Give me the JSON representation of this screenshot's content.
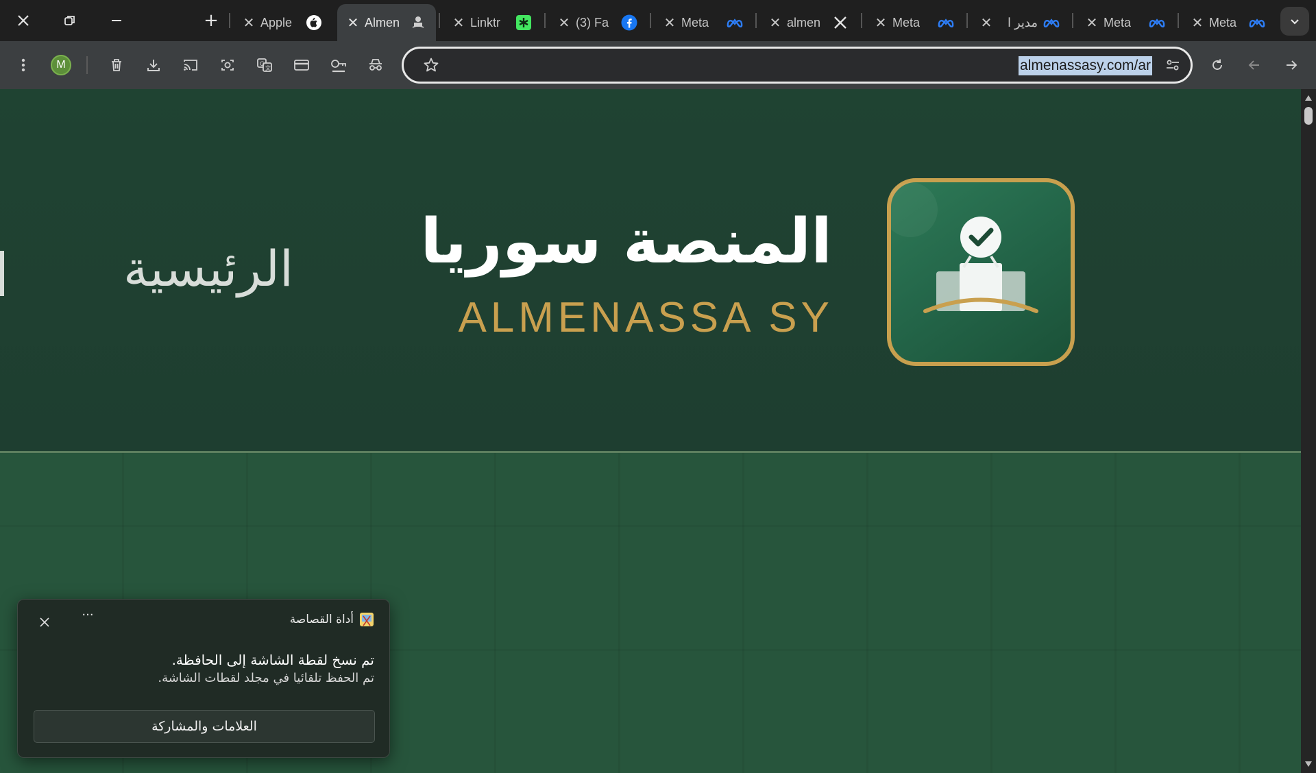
{
  "tabs": [
    {
      "title": "Apple",
      "favicon": "apple-icon"
    },
    {
      "title": "Almen",
      "favicon": "almenassa-icon",
      "active": true
    },
    {
      "title": "Linktr",
      "favicon": "linktree-icon"
    },
    {
      "title": "(3) Fa",
      "favicon": "facebook-icon"
    },
    {
      "title": "Meta",
      "favicon": "meta-icon"
    },
    {
      "title": "almen",
      "favicon": "x-icon"
    },
    {
      "title": "Meta",
      "favicon": "meta-icon"
    },
    {
      "title": "مدير ا",
      "favicon": "meta-icon"
    },
    {
      "title": "Meta",
      "favicon": "meta-icon"
    },
    {
      "title": "Meta",
      "favicon": "meta-icon"
    }
  ],
  "toolbar": {
    "avatar_initial": "M",
    "url": "almenassasy.com/ar"
  },
  "page": {
    "nav_home": "الرئيسية",
    "logo_ar": "المنصة سوريا",
    "logo_en": "ALMENASSA SY"
  },
  "toast": {
    "app_name": "أداة القصاصة",
    "line1": "تم نسخ لقطة الشاشة إلى الحافظة.",
    "line2": "تم الحفظ تلقائيا في مجلد لقطات الشاشة.",
    "button": "العلامات والمشاركة",
    "more": "···"
  },
  "colors": {
    "hero_bg": "#1f4332",
    "content_bg": "#27553c",
    "gold": "#c9a04f",
    "url_highlight": "#bcd1ea",
    "tab_active": "#3c3f41"
  }
}
